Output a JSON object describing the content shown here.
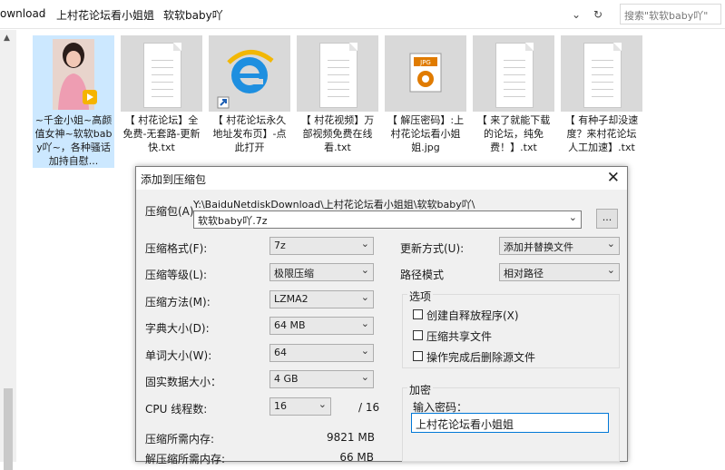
{
  "address_bar": {
    "crumbs": [
      "ownload",
      "上村花论坛看小姐姐",
      "软软baby吖"
    ],
    "dropdown_icon": "chevron-down-icon",
    "refresh_icon": "refresh-icon",
    "search_placeholder": "搜索\"软软baby吖\""
  },
  "files": [
    {
      "name": "~千金小姐~高颜值女神~软软baby吖~，各种骚话加持自慰...",
      "icon": "video-thumbnail",
      "selected": true
    },
    {
      "name": "【 村花论坛】全免费-无套路-更新快.txt",
      "icon": "text-file-icon",
      "selected": false
    },
    {
      "name": "【 村花论坛永久地址发布页】-点此打开",
      "icon": "ie-shortcut-icon",
      "selected": false
    },
    {
      "name": "【 村花视频】万部视频免费在线看.txt",
      "icon": "text-file-icon",
      "selected": false
    },
    {
      "name": "【 解压密码】:上村花论坛看小姐姐.jpg",
      "icon": "jpg-file-icon",
      "selected": false
    },
    {
      "name": "【 来了就能下载的论坛，纯免费！】.txt",
      "icon": "text-file-icon",
      "selected": false
    },
    {
      "name": "【 有种子却没速度？来村花论坛人工加速】.txt",
      "icon": "text-file-icon",
      "selected": false
    }
  ],
  "dialog": {
    "title": "添加到压缩包",
    "archive_label": "压缩包(A)",
    "archive_path": "Y:\\BaiduNetdiskDownload\\上村花论坛看小姐姐\\软软baby吖\\",
    "archive_name": "软软baby吖.7z",
    "browse_label": "...",
    "left": [
      {
        "label": "压缩格式(F):",
        "value": "7z"
      },
      {
        "label": "压缩等级(L):",
        "value": "极限压缩"
      },
      {
        "label": "压缩方法(M):",
        "value": "LZMA2"
      },
      {
        "label": "字典大小(D):",
        "value": "64 MB"
      },
      {
        "label": "单词大小(W):",
        "value": "64"
      },
      {
        "label": "固实数据大小：",
        "value": "4 GB"
      }
    ],
    "cpu_label": "CPU 线程数:",
    "cpu_value": "16",
    "cpu_total": "/ 16",
    "mem_compress_label": "压缩所需内存:",
    "mem_compress_value": "9821 MB",
    "mem_decompress_label": "解压缩所需内存:",
    "mem_decompress_value": "66 MB",
    "update_label": "更新方式(U):",
    "update_value": "添加并替换文件",
    "path_label": "路径模式",
    "path_value": "相对路径",
    "options_title": "选项",
    "options": [
      "创建自释放程序(X)",
      "压缩共享文件",
      "操作完成后删除源文件"
    ],
    "encrypt_title": "加密",
    "password_label": "输入密码：",
    "password_value": "上村花论坛看小姐姐"
  }
}
